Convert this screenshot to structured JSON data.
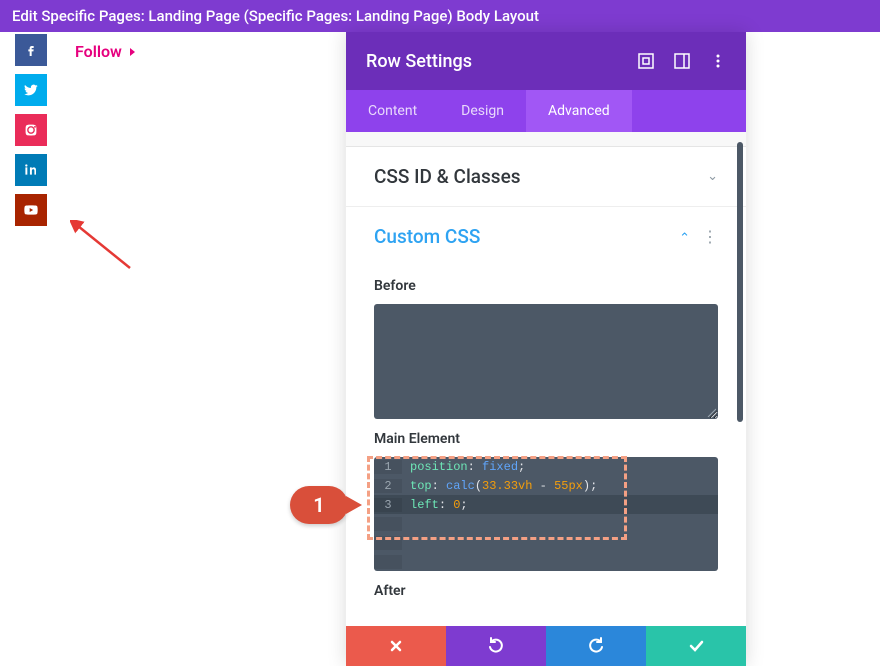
{
  "topbar": {
    "title": "Edit Specific Pages: Landing Page (Specific Pages: Landing Page) Body Layout"
  },
  "follow": {
    "label": "Follow"
  },
  "social": [
    {
      "name": "facebook",
      "color": "#3B5998"
    },
    {
      "name": "twitter",
      "color": "#00ACED"
    },
    {
      "name": "instagram",
      "color": "#EA2C59"
    },
    {
      "name": "linkedin",
      "color": "#007BB6"
    },
    {
      "name": "youtube",
      "color": "#A82400"
    }
  ],
  "panel": {
    "title": "Row Settings",
    "tabs": [
      {
        "label": "Content",
        "active": false
      },
      {
        "label": "Design",
        "active": false
      },
      {
        "label": "Advanced",
        "active": true
      }
    ],
    "sections": {
      "cssid": {
        "title": "CSS ID & Classes",
        "expanded": false
      },
      "customcss": {
        "title": "Custom CSS",
        "expanded": true,
        "before_label": "Before",
        "before_value": "",
        "main_label": "Main Element",
        "main_code": [
          {
            "n": "1",
            "raw": "position: fixed;"
          },
          {
            "n": "2",
            "raw": "top: calc(33.33vh - 55px);"
          },
          {
            "n": "3",
            "raw": "left: 0;"
          }
        ],
        "after_label": "After"
      }
    },
    "footer": {
      "cancel": "cancel",
      "undo": "undo",
      "redo": "redo",
      "save": "save"
    }
  },
  "annotation": {
    "number": "1"
  }
}
